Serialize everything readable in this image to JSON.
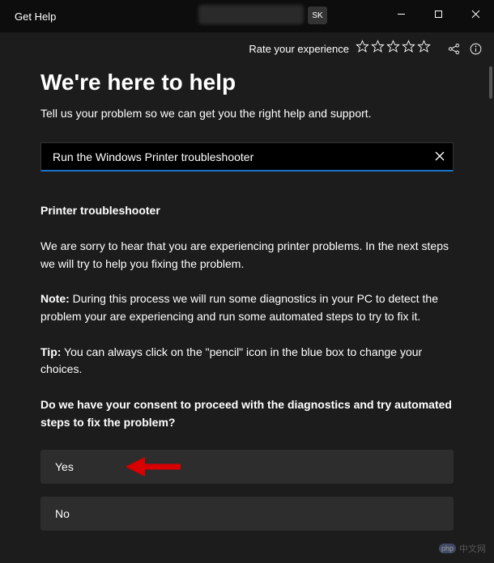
{
  "window": {
    "title": "Get Help",
    "badge": "SK"
  },
  "toolbar": {
    "rate_label": "Rate your experience"
  },
  "main": {
    "heading": "We're here to help",
    "subtitle": "Tell us your problem so we can get you the right help and support.",
    "search_value": "Run the Windows Printer troubleshooter",
    "section_title": "Printer troubleshooter",
    "para_intro": "We are sorry to hear that you are experiencing printer problems. In the next steps we will try to help you fixing the problem.",
    "note_label": "Note:",
    "note_text": " During this process we will run some diagnostics in your PC to detect the problem your are experiencing and run some automated steps to try to fix it.",
    "tip_label": "Tip:",
    "tip_text": " You can always click on the \"pencil\" icon in the blue box to change your choices.",
    "consent_question": "Do we have your consent to proceed with the diagnostics and try automated steps to fix the problem?",
    "yes_label": "Yes",
    "no_label": "No"
  },
  "watermark": {
    "logo": "php",
    "text": "中文网"
  }
}
